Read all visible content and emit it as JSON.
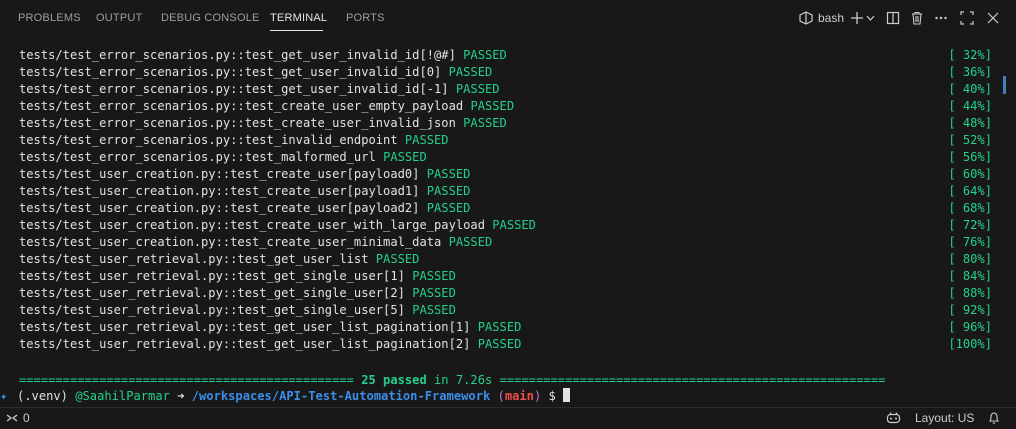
{
  "panel": {
    "tabs": [
      {
        "label": "PROBLEMS"
      },
      {
        "label": "OUTPUT"
      },
      {
        "label": "DEBUG CONSOLE"
      },
      {
        "label": "TERMINAL",
        "active": true
      },
      {
        "label": "PORTS"
      }
    ],
    "terminal_name": "bash",
    "icons": [
      "terminal-icon",
      "plus-icon",
      "chevron-down-icon",
      "split-icon",
      "trash-icon",
      "more-icon",
      "maximize-icon",
      "close-icon"
    ]
  },
  "terminal": {
    "lines": [
      {
        "test": "tests/test_error_scenarios.py::test_get_user_invalid_id[!@#]",
        "status": "PASSED",
        "percent": "[ 32%]"
      },
      {
        "test": "tests/test_error_scenarios.py::test_get_user_invalid_id[0]",
        "status": "PASSED",
        "percent": "[ 36%]"
      },
      {
        "test": "tests/test_error_scenarios.py::test_get_user_invalid_id[-1]",
        "status": "PASSED",
        "percent": "[ 40%]"
      },
      {
        "test": "tests/test_error_scenarios.py::test_create_user_empty_payload",
        "status": "PASSED",
        "percent": "[ 44%]"
      },
      {
        "test": "tests/test_error_scenarios.py::test_create_user_invalid_json",
        "status": "PASSED",
        "percent": "[ 48%]"
      },
      {
        "test": "tests/test_error_scenarios.py::test_invalid_endpoint",
        "status": "PASSED",
        "percent": "[ 52%]"
      },
      {
        "test": "tests/test_error_scenarios.py::test_malformed_url",
        "status": "PASSED",
        "percent": "[ 56%]"
      },
      {
        "test": "tests/test_user_creation.py::test_create_user[payload0]",
        "status": "PASSED",
        "percent": "[ 60%]"
      },
      {
        "test": "tests/test_user_creation.py::test_create_user[payload1]",
        "status": "PASSED",
        "percent": "[ 64%]"
      },
      {
        "test": "tests/test_user_creation.py::test_create_user[payload2]",
        "status": "PASSED",
        "percent": "[ 68%]"
      },
      {
        "test": "tests/test_user_creation.py::test_create_user_with_large_payload",
        "status": "PASSED",
        "percent": "[ 72%]"
      },
      {
        "test": "tests/test_user_creation.py::test_create_user_minimal_data",
        "status": "PASSED",
        "percent": "[ 76%]"
      },
      {
        "test": "tests/test_user_retrieval.py::test_get_user_list",
        "status": "PASSED",
        "percent": "[ 80%]"
      },
      {
        "test": "tests/test_user_retrieval.py::test_get_single_user[1]",
        "status": "PASSED",
        "percent": "[ 84%]"
      },
      {
        "test": "tests/test_user_retrieval.py::test_get_single_user[2]",
        "status": "PASSED",
        "percent": "[ 88%]"
      },
      {
        "test": "tests/test_user_retrieval.py::test_get_single_user[5]",
        "status": "PASSED",
        "percent": "[ 92%]"
      },
      {
        "test": "tests/test_user_retrieval.py::test_get_user_list_pagination[1]",
        "status": "PASSED",
        "percent": "[ 96%]"
      },
      {
        "test": "tests/test_user_retrieval.py::test_get_user_list_pagination[2]",
        "status": "PASSED",
        "percent": "[100%]"
      }
    ],
    "summary_left": "============================================== ",
    "summary_text": "25 passed",
    "summary_time": " in 7.26s ",
    "summary_right": "=====================================================",
    "prompt": {
      "venv": "(.venv) ",
      "user": "@SaahilParmar",
      "arrow": " ➜ ",
      "path": "/workspaces/API-Test-Automation-Framework",
      "branch_open": " (",
      "branch": "main",
      "branch_close": ")",
      "symbol": " $ "
    }
  },
  "statusbar": {
    "remote_count": "0",
    "layout": "Layout: US"
  }
}
